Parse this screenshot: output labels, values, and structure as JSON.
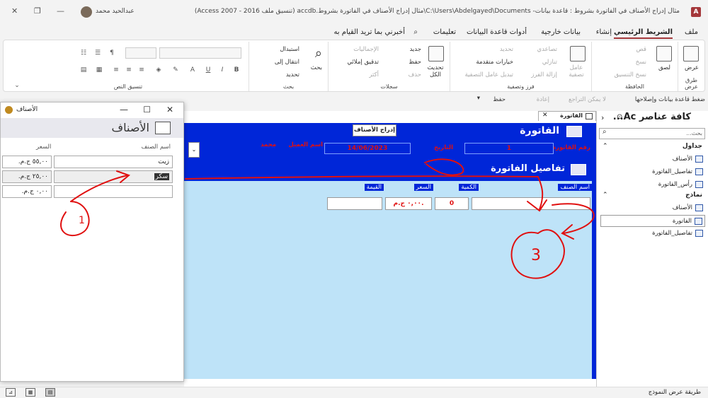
{
  "titlebar": {
    "doc_title": "مثال إدراج الأصناف في الفاتورة بشروط : قاعدة بيانات- C:\\Users\\Abdelgayed\\Documents\\مثال إدراج الأصناف في الفاتورة بشروط.accdb (تنسيق ملف Access 2007 - 2016)",
    "app": "Access",
    "user": "عبدالحيد محمد",
    "app_icon": "A"
  },
  "menu": {
    "tabs": [
      "ملف",
      "الشريط الرئيسي",
      "إنشاء",
      "بيانات خارجية",
      "أدوات قاعدة البيانات",
      "تعليمات"
    ],
    "tell_me": "أخبرني بما تريد القيام به"
  },
  "ribbon": {
    "views": {
      "view": "عرض",
      "group": "طرق عرض"
    },
    "clipboard": {
      "paste": "لصق",
      "cut": "قص",
      "copy": "نسخ",
      "format_painter": "نسخ التنسيق",
      "group": "الحافظة"
    },
    "sort_filter": {
      "filter": "عامل تصفية",
      "ascending": "تصاعدي",
      "descending": "تنازلي",
      "remove_sort": "إزالة الفرز",
      "selection": "تحديد",
      "advanced": "خيارات متقدمة",
      "toggle_filter": "تبديل عامل التصفية",
      "group": "فرز وتصفية"
    },
    "records": {
      "refresh_all": "تحديث الكل",
      "new": "جديد",
      "save": "حفظ",
      "delete": "حذف",
      "totals": "الإجماليات",
      "spelling": "تدقيق إملائي",
      "more": "أكثر",
      "group": "سجلات"
    },
    "find": {
      "find": "بحث",
      "replace": "استبدال",
      "goto": "انتقال إلى",
      "select": "تحديد",
      "group": "بحث"
    },
    "text_format": {
      "group": "تنسيق النص"
    }
  },
  "msgbar": {
    "compact": "ضغط قاعدة بيانات وإصلاحها",
    "undo": "لا يمكن التراجع",
    "redo": "إعادة",
    "save": "حفظ"
  },
  "items_window": {
    "title": "الأصناف",
    "header_title": "الأصناف",
    "col_name": "اسم الصنف",
    "col_price": "السعر",
    "rows": [
      {
        "name": "زيت",
        "price": "٥٥,٠٠ ج.م."
      },
      {
        "name": "سكر",
        "price": "٢٥,٠٠ ج.م."
      },
      {
        "name": "",
        "price": "٠,٠٠ ج.م."
      }
    ]
  },
  "invoice_form": {
    "tab_label": "الفاتورة",
    "title": "الفاتورة",
    "insert_button": "إدراج الأصناف",
    "invoice_no_label": "رقم الفاتورة",
    "invoice_no": "1",
    "date_label": "التاريخ",
    "date": "14/06/2023",
    "customer_label": "اسم العميل",
    "customer": "محمد",
    "details_title": "تفاصيل الفاتورة",
    "col_item": "اسم الصنف",
    "col_qty": "الكمية",
    "col_price": "السعر",
    "col_value": "القيمة",
    "row_qty": "0",
    "row_price": "٠,٠٠ ج.م."
  },
  "nav": {
    "title": "كافة عناصر Ac...",
    "search_placeholder": "بحث...",
    "sec_tables": "جداول",
    "sec_forms": "نماذج",
    "tables": [
      "الأصناف",
      "تفاصيل_الفاتورة",
      "رأس_الفاتورة"
    ],
    "forms": [
      "الأصناف",
      "الفاتورة",
      "تفاصيل_الفاتورة"
    ]
  },
  "status": {
    "text": "طريقة عرض النموذج"
  },
  "annotations": {
    "one": "1",
    "three": "3"
  },
  "colors": {
    "form_blue": "#0026d8",
    "detail_bg": "#bee3f8",
    "label_red": "#e01010",
    "annot_red": "#e01010",
    "access_red": "#a4373a"
  }
}
